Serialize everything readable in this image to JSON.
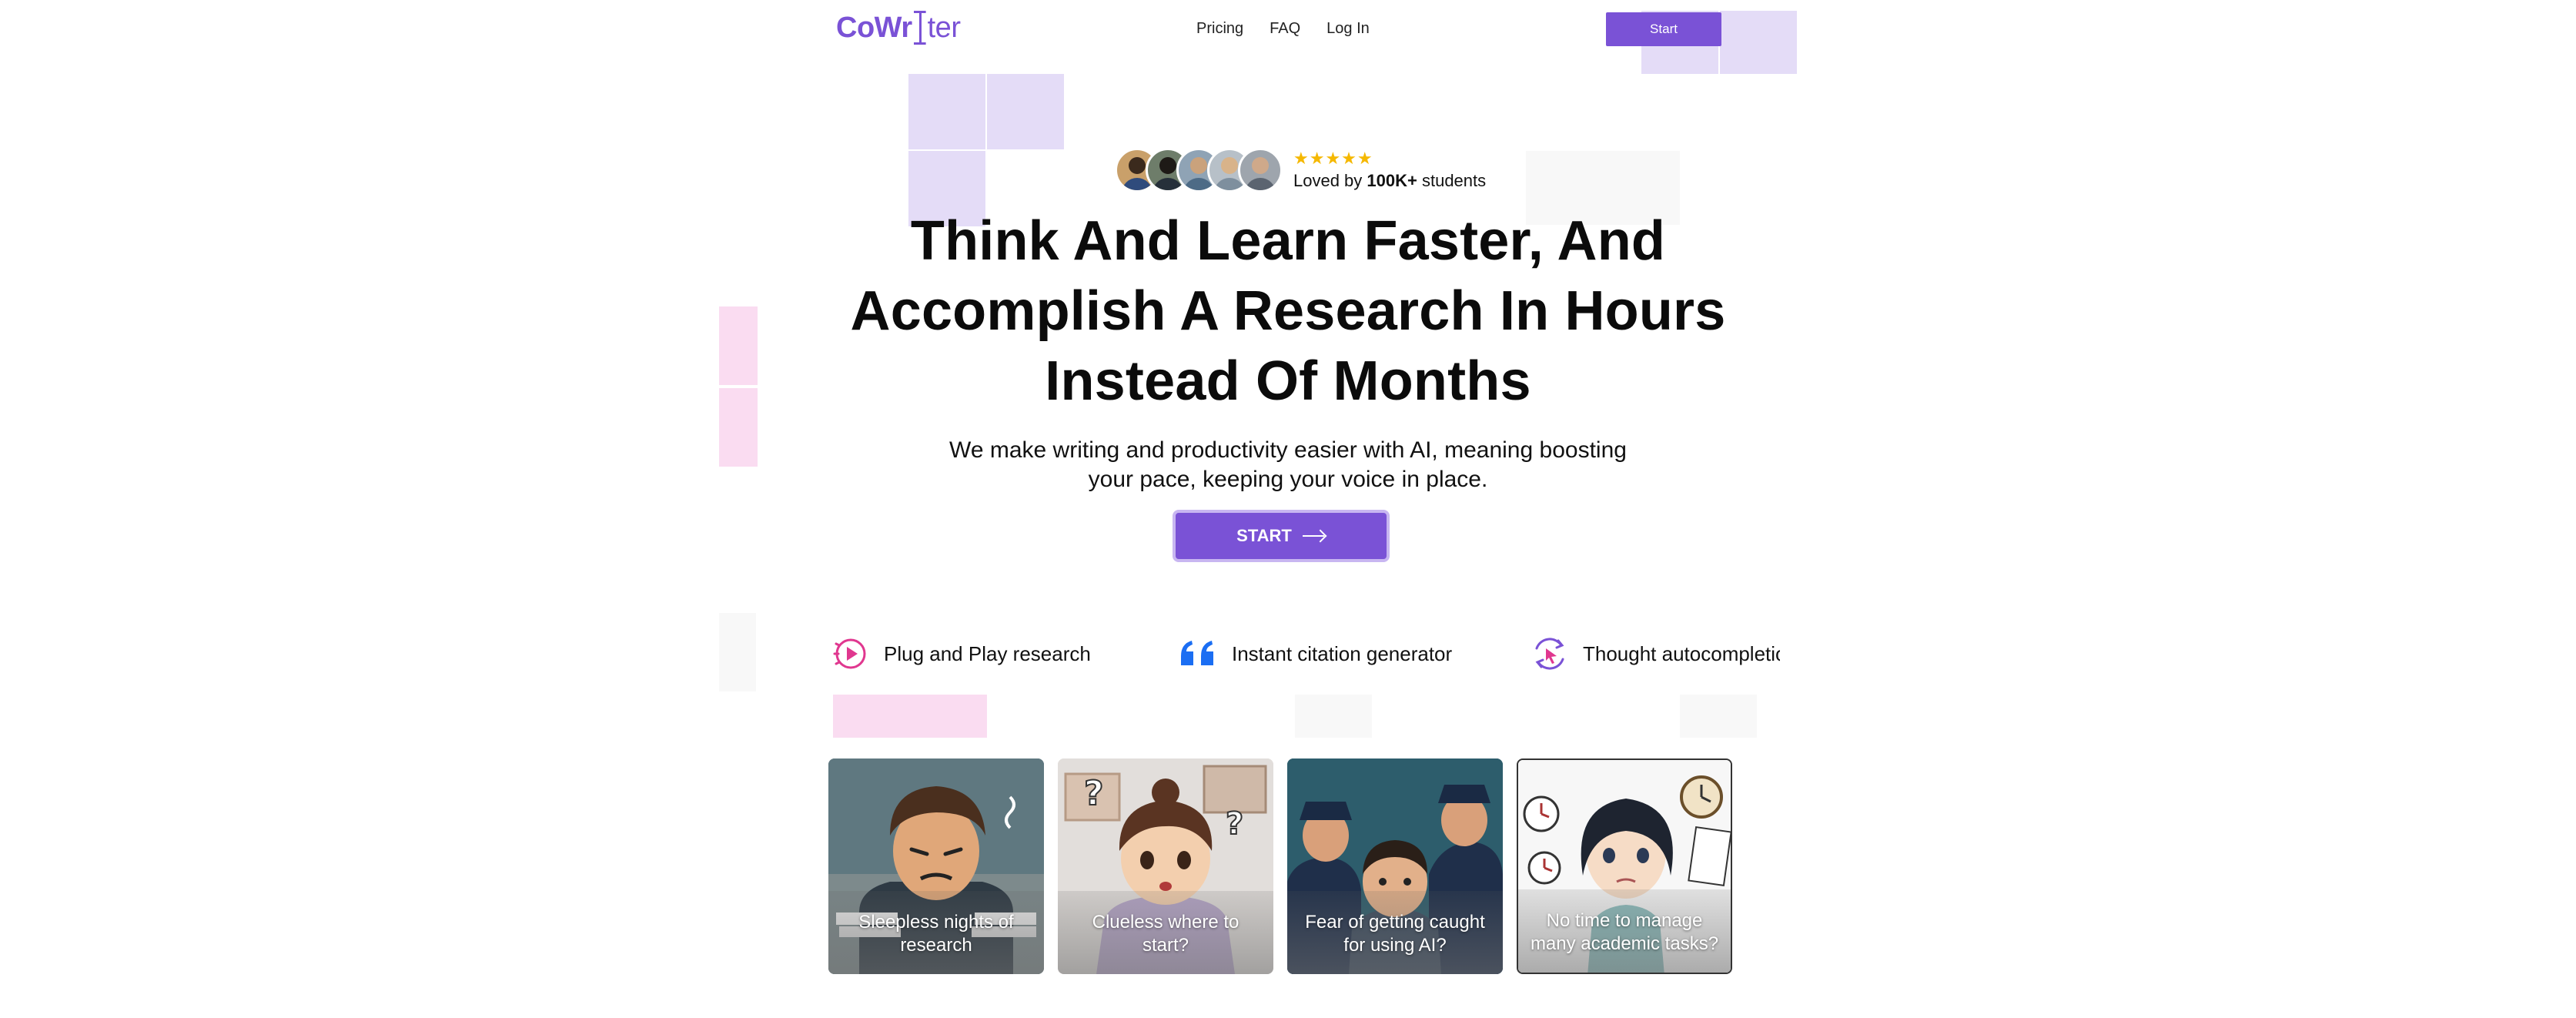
{
  "nav": {
    "logo_part1": "CoWr",
    "logo_part2": "ter",
    "links": [
      "Pricing",
      "FAQ",
      "Log In"
    ],
    "start_label": "Start"
  },
  "hero": {
    "stars": "★★★★★",
    "loved_prefix": "Loved by ",
    "loved_count": "100K+",
    "loved_suffix": " students",
    "title": "Think And Learn Faster, And Accomplish A Research In Hours Instead Of Months",
    "subtitle": "We make writing and productivity easier with AI, meaning boosting your pace, keeping your voice in place.",
    "cta_label": "START"
  },
  "features": [
    {
      "label": "Plug and Play research",
      "icon": "play-circle-icon"
    },
    {
      "label": "Instant citation generator",
      "icon": "quote-icon"
    },
    {
      "label": "Thought autocompletion",
      "icon": "cursor-refresh-icon"
    }
  ],
  "cards": [
    {
      "caption": "Sleepless nights of research"
    },
    {
      "caption": "Clueless where to start?"
    },
    {
      "caption": "Fear of getting caught for using AI?"
    },
    {
      "caption": "No time to manage many academic tasks?"
    }
  ],
  "colors": {
    "brand": "#7a52d6",
    "star": "#f5b800",
    "citation_blue": "#1b6ef3",
    "feature_pink": "#e0378f"
  }
}
